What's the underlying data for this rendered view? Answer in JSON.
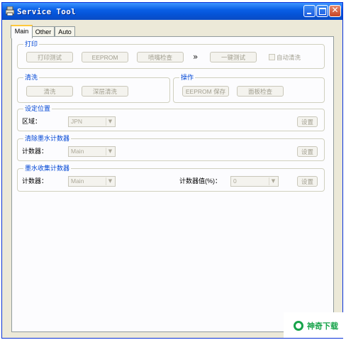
{
  "window": {
    "title": "Service Tool"
  },
  "tabs": [
    {
      "label": "Main",
      "active": true
    },
    {
      "label": "Other",
      "active": false
    },
    {
      "label": "Auto",
      "active": false
    }
  ],
  "print_group": {
    "title": "打印",
    "buttons": [
      "打印测试",
      "EEPROM",
      "喷嘴检查",
      "一键测试"
    ],
    "arrows": "»",
    "auto_clean_label": "自动清洗"
  },
  "clean_group": {
    "title": "清洗",
    "buttons": [
      "清洗",
      "深层清洗"
    ]
  },
  "operate_group": {
    "title": "操作",
    "buttons": [
      "EEPROM 保存",
      "面板检查"
    ]
  },
  "location_group": {
    "title": "设定位置",
    "label": "区域：",
    "value": "JPN",
    "set_button": "设置"
  },
  "clear_ink_group": {
    "title": "清除墨水计数器",
    "label": "计数器：",
    "value": "Main",
    "set_button": "设置"
  },
  "ink_collect_group": {
    "title": "墨水收集计数器",
    "label": "计数器：",
    "value": "Main",
    "value_label": "计数器值(%)：",
    "counter_value": "0",
    "set_button": "设置"
  },
  "watermark": {
    "text": "神奇下载"
  },
  "colors": {
    "titlebar": "#0553d6",
    "group_title": "#0046d5",
    "disabled_text": "#a19e8f"
  }
}
